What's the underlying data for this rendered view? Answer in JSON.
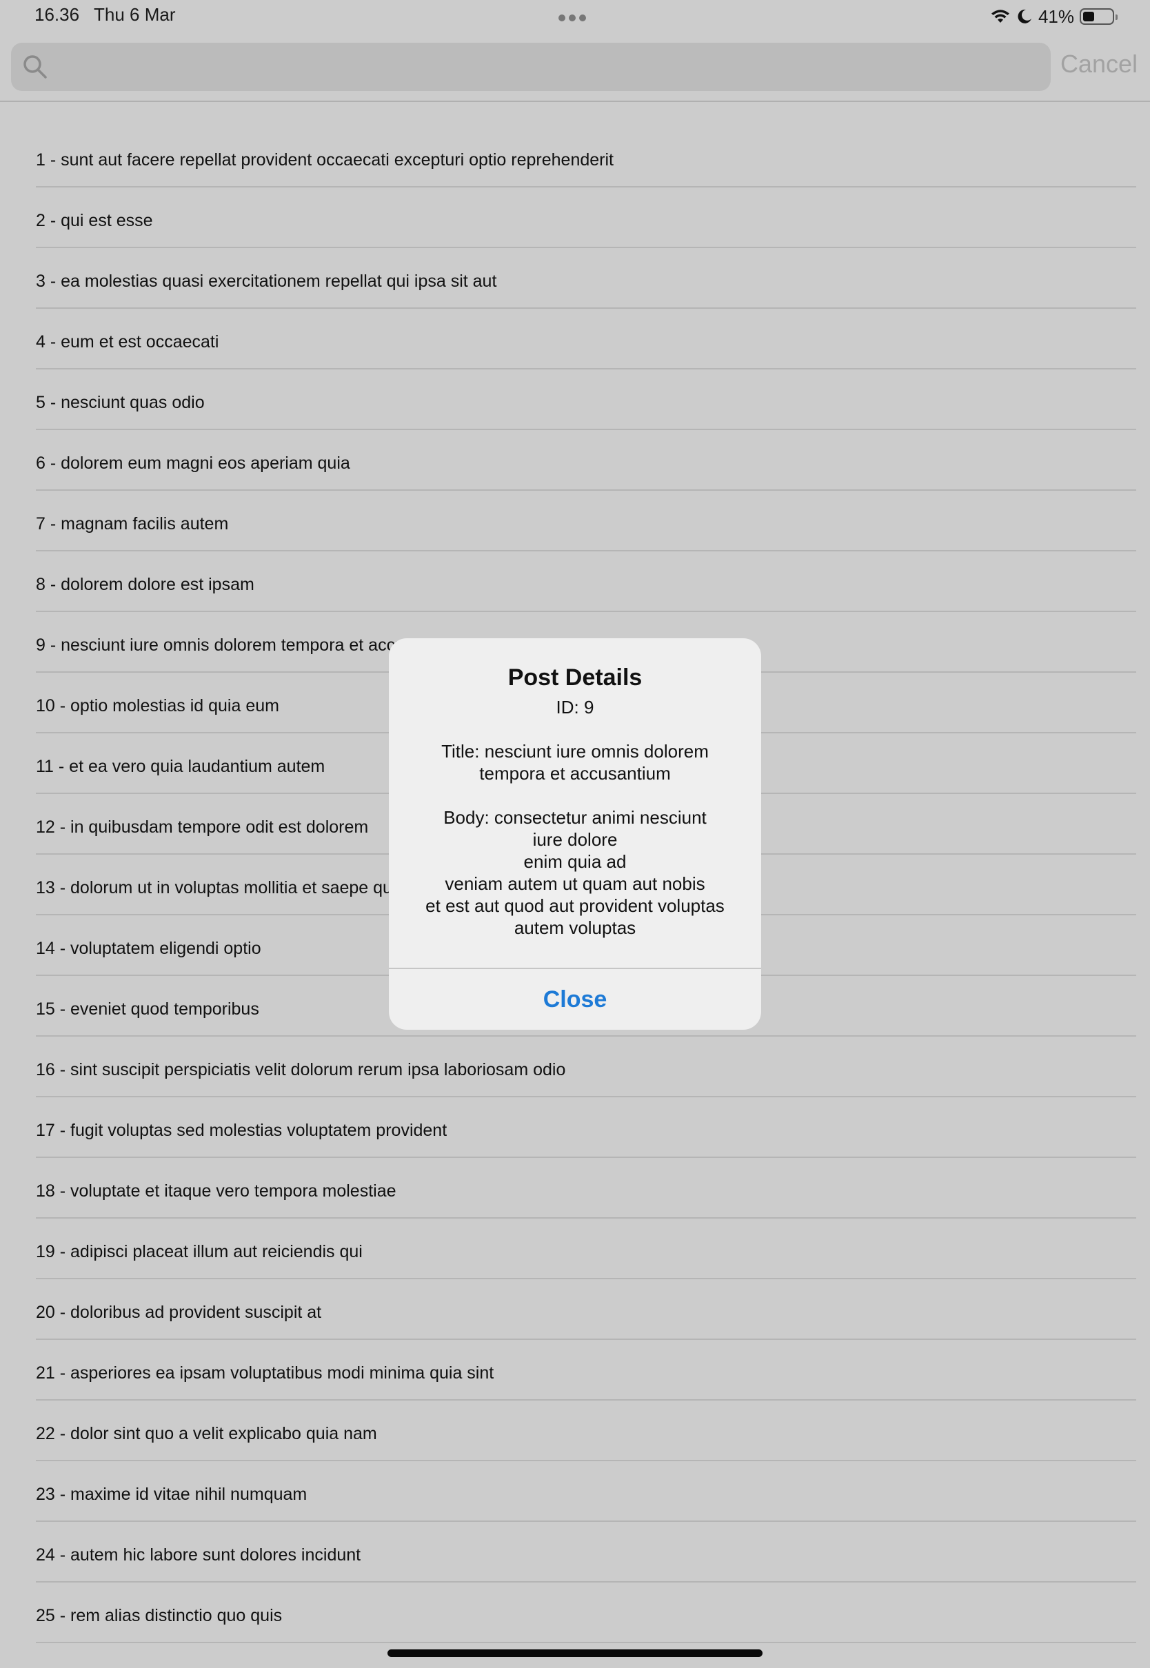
{
  "status_bar": {
    "time": "16.36",
    "date": "Thu 6 Mar",
    "battery_percent": "41%",
    "battery_level": 0.41,
    "icons": [
      "wifi-icon",
      "moon-icon",
      "battery-icon"
    ]
  },
  "search": {
    "placeholder": "",
    "value": "",
    "cancel_label": "Cancel"
  },
  "posts": [
    "1 - sunt aut facere repellat provident occaecati excepturi optio reprehenderit",
    "2 - qui est esse",
    "3 - ea molestias quasi exercitationem repellat qui ipsa sit aut",
    "4 - eum et est occaecati",
    "5 - nesciunt quas odio",
    "6 - dolorem eum magni eos aperiam quia",
    "7 - magnam facilis autem",
    "8 - dolorem dolore est ipsam",
    "9 - nesciunt iure omnis dolorem tempora et accusantium",
    "10 - optio molestias id quia eum",
    "11 - et ea vero quia laudantium autem",
    "12 - in quibusdam tempore odit est dolorem",
    "13 - dolorum ut in voluptas mollitia et saepe quo animi",
    "14 - voluptatem eligendi optio",
    "15 - eveniet quod temporibus",
    "16 - sint suscipit perspiciatis velit dolorum rerum ipsa laboriosam odio",
    "17 - fugit voluptas sed molestias voluptatem provident",
    "18 - voluptate et itaque vero tempora molestiae",
    "19 - adipisci placeat illum aut reiciendis qui",
    "20 - doloribus ad provident suscipit at",
    "21 - asperiores ea ipsam voluptatibus modi minima quia sint",
    "22 - dolor sint quo a velit explicabo quia nam",
    "23 - maxime id vitae nihil numquam",
    "24 - autem hic labore sunt dolores incidunt",
    "25 - rem alias distinctio quo quis"
  ],
  "alert": {
    "title": "Post Details",
    "id_line": "ID: 9",
    "title_line_1": "Title: nesciunt iure omnis dolorem",
    "title_line_2": "tempora et accusantium",
    "body_line_1": "Body: consectetur animi nesciunt",
    "body_line_2": "iure dolore",
    "body_line_3": "enim quia ad",
    "body_line_4": "veniam autem ut quam aut nobis",
    "body_line_5": "et est aut quod aut provident voluptas",
    "body_line_6": "autem voluptas",
    "close_label": "Close"
  },
  "colors": {
    "background_dimmed": "#cccccc",
    "alert_background": "#efefef",
    "accent": "#1d7ad6",
    "cancel_disabled": "#a2a2a2"
  }
}
